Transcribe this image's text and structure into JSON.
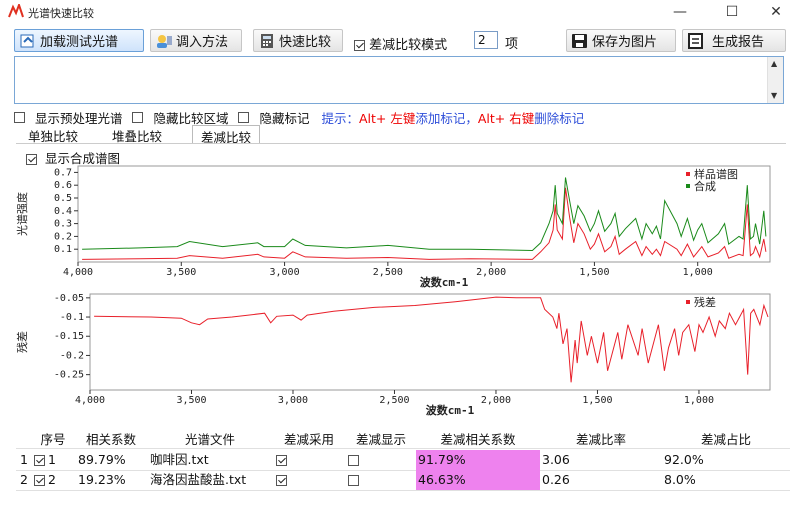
{
  "window": {
    "title": "光谱快速比较",
    "controls": [
      "—",
      "☐",
      "✕"
    ]
  },
  "toolbar": {
    "load_label": "加载测试光谱",
    "method_label": "调入方法",
    "quick_label": "快速比较",
    "diff_mode_label": "差减比较模式",
    "diff_mode_checked": true,
    "count_value": "2",
    "count_unit": "项",
    "save_img_label": "保存为图片",
    "report_label": "生成报告"
  },
  "options": {
    "preprocess_label": "显示预处理光谱",
    "hide_region_label": "隐藏比较区域",
    "hide_mark_label": "隐藏标记",
    "hint_prefix": "提示：",
    "hint_key1": "Alt+ 左键",
    "hint_mid": "添加标记，",
    "hint_key2": "Alt+ 右键",
    "hint_suffix": "删除标记"
  },
  "tabs": [
    {
      "label": "单独比较"
    },
    {
      "label": "堆叠比较"
    },
    {
      "label": "差减比较"
    }
  ],
  "show_composite_label": "显示合成谱图",
  "chart_data": [
    {
      "type": "line",
      "ylabel": "光谱强度",
      "xlabel": "波数cm-1",
      "xlim": [
        4000,
        650
      ],
      "ylim": [
        0,
        0.75
      ],
      "x_ticks": [
        4000,
        3500,
        3000,
        2500,
        2000,
        1500,
        1000
      ],
      "x_tick_labels": [
        "4,000",
        "3,500",
        "3,000",
        "2,500",
        "2,000",
        "1,500",
        "1,000"
      ],
      "y_ticks": [
        0.1,
        0.2,
        0.3,
        0.4,
        0.5,
        0.6,
        0.7
      ],
      "y_tick_labels": [
        "0.1",
        "0.2",
        "0.3",
        "0.4",
        "0.5",
        "0.6",
        "0.7"
      ],
      "legend": "top-right",
      "series": [
        {
          "name": "样品谱图",
          "color": "#e8202a",
          "x": [
            3980,
            3700,
            3520,
            3460,
            3300,
            3130,
            3100,
            3000,
            2960,
            2900,
            2700,
            2500,
            2300,
            2100,
            1800,
            1760,
            1720,
            1700,
            1690,
            1680,
            1655,
            1640,
            1620,
            1600,
            1580,
            1550,
            1520,
            1500,
            1480,
            1450,
            1420,
            1400,
            1380,
            1350,
            1300,
            1270,
            1250,
            1220,
            1200,
            1180,
            1160,
            1100,
            1080,
            1050,
            1020,
            1000,
            980,
            950,
            900,
            870,
            850,
            800,
            780,
            760,
            745,
            730,
            720,
            700,
            680,
            670
          ],
          "y": [
            0.02,
            0.025,
            0.03,
            0.05,
            0.03,
            0.06,
            0.04,
            0.03,
            0.08,
            0.04,
            0.03,
            0.035,
            0.02,
            0.025,
            0.02,
            0.08,
            0.15,
            0.25,
            0.45,
            0.25,
            0.18,
            0.58,
            0.35,
            0.15,
            0.3,
            0.22,
            0.1,
            0.14,
            0.22,
            0.08,
            0.12,
            0.2,
            0.06,
            0.1,
            0.16,
            0.05,
            0.12,
            0.06,
            0.1,
            0.05,
            0.16,
            0.1,
            0.05,
            0.14,
            0.04,
            0.08,
            0.12,
            0.04,
            0.07,
            0.12,
            0.03,
            0.06,
            0.05,
            0.45,
            0.05,
            0.07,
            0.12,
            0.04,
            0.18,
            0.08
          ]
        },
        {
          "name": "合成",
          "color": "#1a8a1a",
          "x": [
            3980,
            3700,
            3520,
            3460,
            3300,
            3130,
            3100,
            3000,
            2960,
            2900,
            2700,
            2500,
            2300,
            2100,
            1800,
            1760,
            1720,
            1700,
            1690,
            1680,
            1655,
            1640,
            1620,
            1600,
            1580,
            1550,
            1520,
            1500,
            1480,
            1450,
            1420,
            1400,
            1380,
            1350,
            1300,
            1270,
            1250,
            1220,
            1200,
            1180,
            1160,
            1100,
            1080,
            1050,
            1020,
            1000,
            980,
            950,
            900,
            870,
            850,
            800,
            780,
            760,
            745,
            730,
            720,
            700,
            680,
            670
          ],
          "y": [
            0.1,
            0.11,
            0.12,
            0.16,
            0.12,
            0.15,
            0.12,
            0.12,
            0.18,
            0.13,
            0.11,
            0.13,
            0.1,
            0.1,
            0.09,
            0.15,
            0.3,
            0.4,
            0.6,
            0.38,
            0.3,
            0.66,
            0.48,
            0.3,
            0.44,
            0.36,
            0.24,
            0.3,
            0.4,
            0.24,
            0.3,
            0.38,
            0.2,
            0.26,
            0.34,
            0.18,
            0.3,
            0.22,
            0.28,
            0.18,
            0.48,
            0.3,
            0.2,
            0.34,
            0.17,
            0.25,
            0.3,
            0.15,
            0.22,
            0.3,
            0.14,
            0.2,
            0.18,
            0.6,
            0.18,
            0.2,
            0.3,
            0.14,
            0.4,
            0.2
          ]
        }
      ]
    },
    {
      "type": "line",
      "ylabel": "残差",
      "xlabel": "波数cm-1",
      "xlim": [
        4000,
        650
      ],
      "ylim": [
        -0.29,
        -0.04
      ],
      "x_ticks": [
        4000,
        3500,
        3000,
        2500,
        2000,
        1500,
        1000
      ],
      "x_tick_labels": [
        "4,000",
        "3,500",
        "3,000",
        "2,500",
        "2,000",
        "1,500",
        "1,000"
      ],
      "y_ticks": [
        -0.05,
        -0.1,
        -0.15,
        -0.2,
        -0.25
      ],
      "y_tick_labels": [
        "-0.05",
        "-0.1",
        "-0.15",
        "-0.2",
        "-0.25"
      ],
      "legend": "top-right",
      "series": [
        {
          "name": "残差",
          "color": "#e8202a",
          "x": [
            3980,
            3700,
            3550,
            3500,
            3460,
            3420,
            3300,
            3140,
            3110,
            3080,
            3000,
            2960,
            2930,
            2800,
            2600,
            2400,
            2200,
            2000,
            1900,
            1780,
            1760,
            1720,
            1700,
            1690,
            1670,
            1650,
            1630,
            1610,
            1600,
            1580,
            1550,
            1530,
            1500,
            1470,
            1450,
            1420,
            1400,
            1380,
            1350,
            1300,
            1280,
            1250,
            1220,
            1200,
            1170,
            1150,
            1120,
            1100,
            1080,
            1050,
            1020,
            1000,
            980,
            950,
            920,
            900,
            870,
            850,
            820,
            800,
            780,
            760,
            745,
            730,
            700,
            680,
            660
          ],
          "y": [
            -0.098,
            -0.1,
            -0.103,
            -0.115,
            -0.12,
            -0.105,
            -0.1,
            -0.09,
            -0.115,
            -0.098,
            -0.095,
            -0.108,
            -0.095,
            -0.085,
            -0.075,
            -0.07,
            -0.06,
            -0.048,
            -0.05,
            -0.05,
            -0.08,
            -0.1,
            -0.13,
            -0.09,
            -0.17,
            -0.13,
            -0.27,
            -0.16,
            -0.22,
            -0.11,
            -0.2,
            -0.15,
            -0.22,
            -0.14,
            -0.24,
            -0.18,
            -0.14,
            -0.21,
            -0.12,
            -0.2,
            -0.13,
            -0.22,
            -0.16,
            -0.12,
            -0.24,
            -0.18,
            -0.13,
            -0.2,
            -0.14,
            -0.12,
            -0.19,
            -0.12,
            -0.14,
            -0.1,
            -0.15,
            -0.11,
            -0.13,
            -0.09,
            -0.12,
            -0.1,
            -0.08,
            -0.25,
            -0.09,
            -0.08,
            -0.12,
            -0.07,
            -0.1
          ]
        }
      ]
    }
  ],
  "table": {
    "headers": [
      "序号",
      "相关系数",
      "光谱文件",
      "差减采用",
      "差减显示",
      "差减相关系数",
      "差减比率",
      "差减占比"
    ],
    "rows": [
      {
        "row_num": "1",
        "seq": "1",
        "corr": "89.79%",
        "file": "咖啡因.txt",
        "use": true,
        "show": false,
        "diff_corr": "91.79%",
        "ratio": "3.06",
        "share": "92.0%"
      },
      {
        "row_num": "2",
        "seq": "2",
        "corr": "19.23%",
        "file": "海洛因盐酸盐.txt",
        "use": true,
        "show": false,
        "diff_corr": "46.63%",
        "ratio": "0.26",
        "share": "8.0%"
      }
    ]
  }
}
